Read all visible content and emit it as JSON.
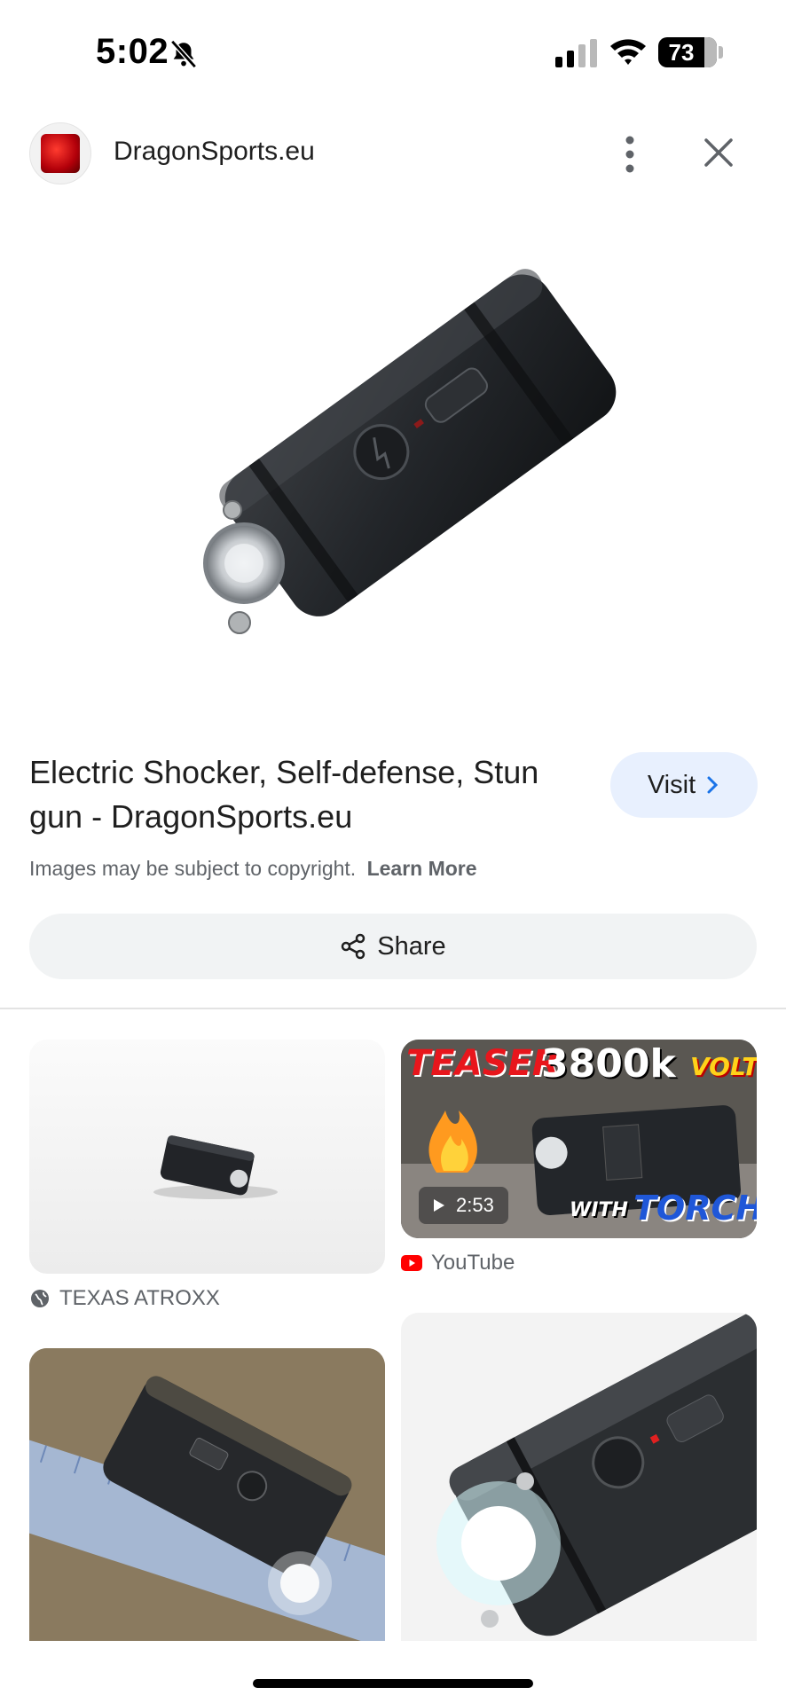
{
  "status_bar": {
    "time": "5:02",
    "battery": "73"
  },
  "header": {
    "site_name": "DragonSports.eu",
    "icons": [
      "site-logo",
      "more-vert-icon",
      "close-icon"
    ]
  },
  "result": {
    "title": "Electric Shocker, Self-defense, Stun gun - DragonSports.eu",
    "visit_label": "Visit",
    "copyright_text": "Images may be subject to copyright.",
    "learn_more_label": "Learn More",
    "share_label": "Share"
  },
  "related": [
    {
      "source": "TEXAS ATROXX",
      "source_icon": "globe-icon"
    },
    {
      "source": "YouTube",
      "source_icon": "youtube-icon",
      "duration": "2:53",
      "thumb_text": [
        "TEASER",
        "3800k",
        "VOLTS",
        "WITH",
        "TORCH"
      ]
    },
    {
      "source": ""
    },
    {
      "source": ""
    }
  ],
  "colors": {
    "visit_bg": "#e8f0fe",
    "share_bg": "#f1f3f4",
    "youtube_red": "#ff0000"
  }
}
